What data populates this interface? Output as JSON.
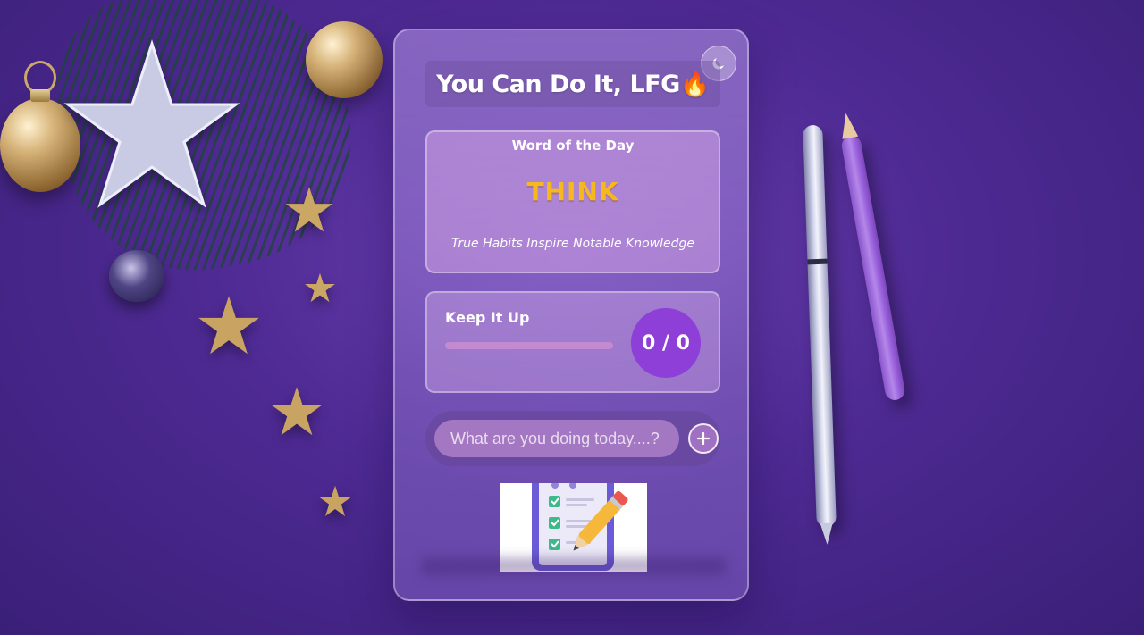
{
  "app": {
    "title": "You Can Do It, LFG🔥"
  },
  "theme_toggle": {
    "icon": "moon-icon"
  },
  "word_of_day": {
    "label": "Word of the Day",
    "word": "THINK",
    "meaning": "True Habits Inspire Notable Knowledge"
  },
  "progress": {
    "label": "Keep It Up",
    "completed": 0,
    "total": 0,
    "count_text": "0 / 0"
  },
  "task_input": {
    "value": "",
    "placeholder": "What are you doing today....?"
  },
  "add_button": {
    "icon": "plus-icon"
  },
  "illustration": {
    "icon": "checklist-pencil-illustration"
  },
  "colors": {
    "background": "#4e2a93",
    "accent": "#8d3fd8",
    "word_highlight": "#f5b91e",
    "check": "#3fb98a"
  }
}
